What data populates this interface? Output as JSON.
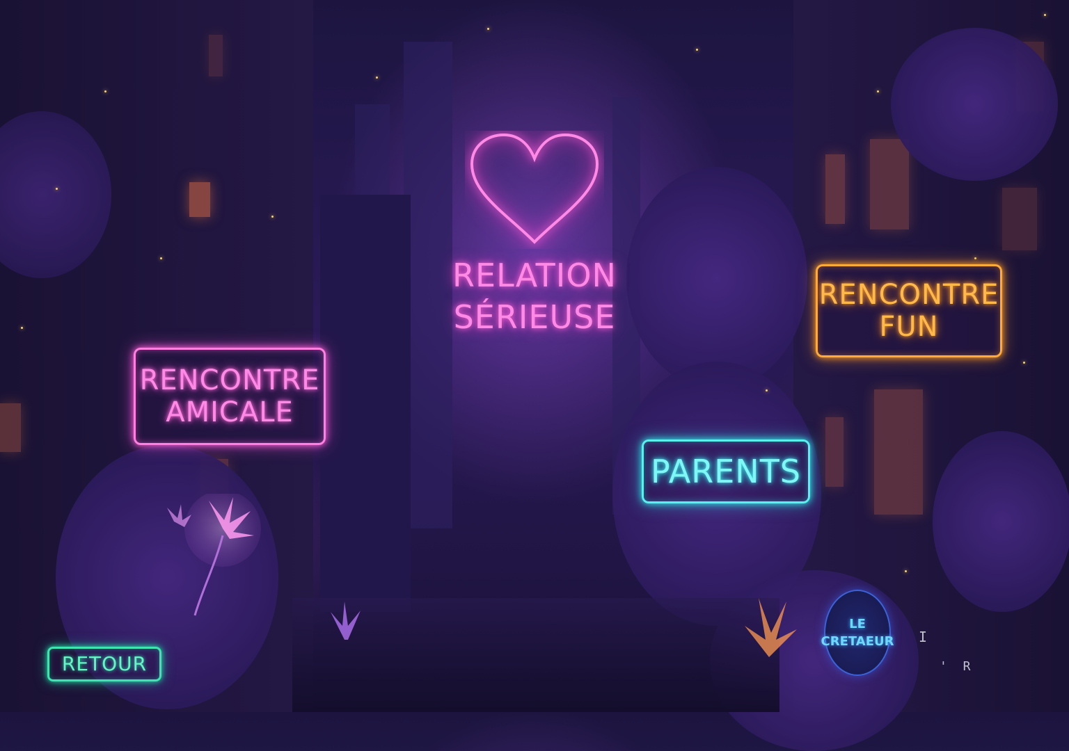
{
  "menu": {
    "serious": {
      "line1": "RELATION",
      "line2": "SÉRIEUSE",
      "icon": "heart-icon"
    },
    "friendly": {
      "line1": "RENCONTRE",
      "line2": "AMICALE"
    },
    "fun": {
      "line1": "RENCONTRE",
      "line2": "FUN"
    },
    "parents": {
      "label": "PARENTS"
    },
    "back": {
      "label": "RETOUR"
    },
    "creator": {
      "line1": "LE",
      "line2": "CRETAEUR"
    },
    "glitch": {
      "text1": "I",
      "text2": "' R"
    }
  },
  "colors": {
    "pink": "#ff80e0",
    "orange": "#ffab3a",
    "cyan": "#59f0ee",
    "green": "#3fe5b0",
    "blue": "#3b63d8"
  }
}
